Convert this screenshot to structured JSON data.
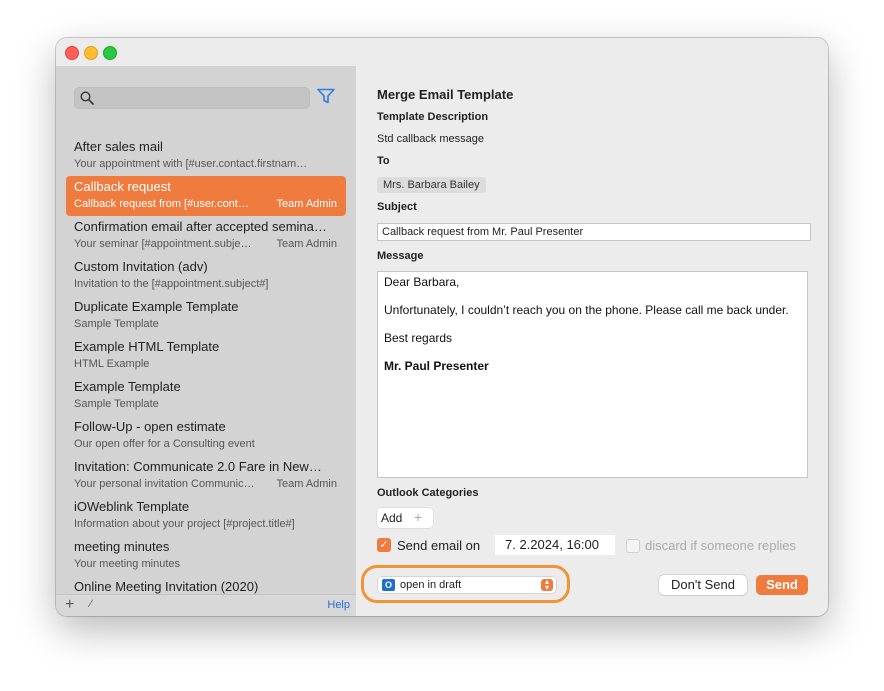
{
  "window": {
    "title": ""
  },
  "sidebar": {
    "search_placeholder": "",
    "items": [
      {
        "title": "After sales mail",
        "subtitle": "Your appointment with [#user.contact.firstnam…",
        "owner": ""
      },
      {
        "title": "Callback request",
        "subtitle": "Callback request from [#user.cont…",
        "owner": "Team Admin",
        "selected": true
      },
      {
        "title": "Confirmation email after accepted semina…",
        "subtitle": "Your seminar [#appointment.subje…",
        "owner": "Team Admin"
      },
      {
        "title": "Custom Invitation (adv)",
        "subtitle": "Invitation to the [#appointment.subject#]",
        "owner": ""
      },
      {
        "title": "Duplicate Example Template",
        "subtitle": "Sample Template",
        "owner": ""
      },
      {
        "title": "Example HTML Template",
        "subtitle": "HTML Example",
        "owner": ""
      },
      {
        "title": "Example Template",
        "subtitle": "Sample Template",
        "owner": ""
      },
      {
        "title": "Follow-Up - open estimate",
        "subtitle": "Our open offer for a Consulting event",
        "owner": ""
      },
      {
        "title": "Invitation: Communicate 2.0 Fare in New…",
        "subtitle": "Your personal invitation Communic…",
        "owner": "Team Admin"
      },
      {
        "title": "iOWeblink Template",
        "subtitle": "Information about your project [#project.title#]",
        "owner": ""
      },
      {
        "title": "meeting minutes",
        "subtitle": "Your meeting minutes",
        "owner": ""
      },
      {
        "title": "Online Meeting Invitation (2020)",
        "subtitle": "",
        "owner": ""
      }
    ],
    "footer": {
      "add": "+",
      "edit": "⁄",
      "help": "Help"
    }
  },
  "main": {
    "heading": "Merge Email Template",
    "description_label": "Template Description",
    "description": "Std callback message",
    "to_label": "To",
    "to": "Mrs. Barbara Bailey",
    "subject_label": "Subject",
    "subject": "Callback request from Mr. Paul Presenter",
    "message_label": "Message",
    "message": {
      "greeting": "Dear  Barbara,",
      "body": "Unfortunately, I couldn’t reach you on the phone. Please call me back under.",
      "closing": "Best regards",
      "signature": "Mr. Paul Presenter"
    },
    "categories_label": "Outlook Categories",
    "add_label": "Add",
    "add_plus": "+",
    "send_on_label": "Send email on",
    "send_on_checked": true,
    "send_date": "7.  2.2024, 16:00",
    "discard_label": "discard if someone replies",
    "discard_checked": false,
    "mode_value": "open in draft",
    "outlook_icon_letter": "O",
    "dont_send": "Don't Send",
    "send": "Send"
  },
  "colors": {
    "accent": "#f07b3f",
    "highlight": "#f19435",
    "help_link": "#2b6bd6"
  }
}
